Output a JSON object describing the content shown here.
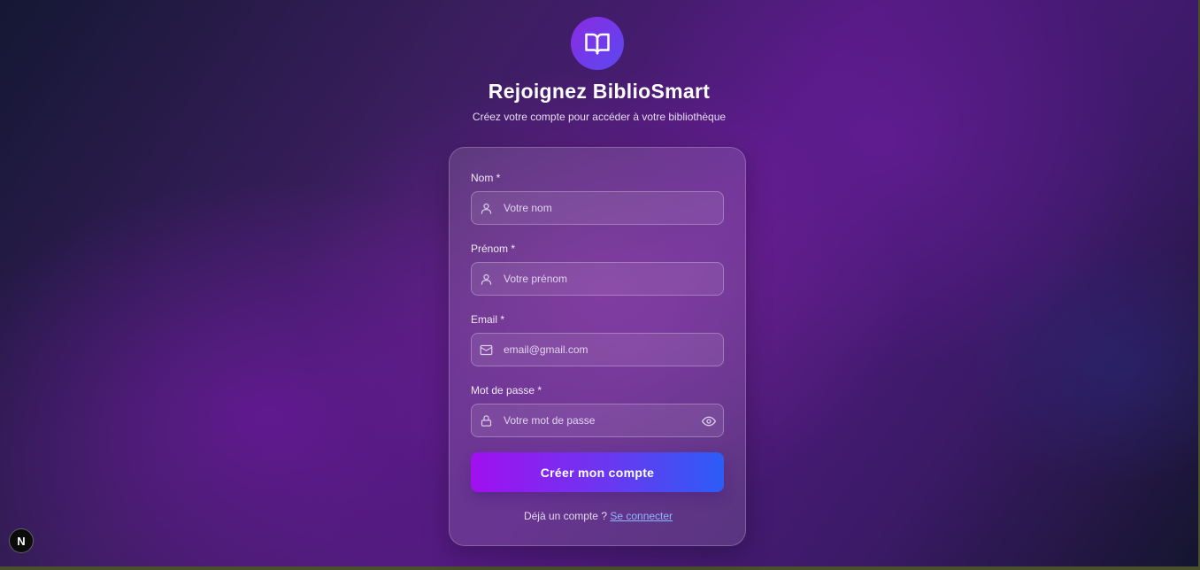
{
  "header": {
    "logo_icon": "open-book-icon",
    "title": "Rejoignez BiblioSmart",
    "subtitle": "Créez votre compte pour accéder à votre bibliothèque"
  },
  "form": {
    "fields": [
      {
        "label": "Nom *",
        "placeholder": "Votre nom",
        "icon": "user-icon"
      },
      {
        "label": "Prénom *",
        "placeholder": "Votre prénom",
        "icon": "user-icon"
      },
      {
        "label": "Email *",
        "placeholder": "email@gmail.com",
        "icon": "mail-icon"
      },
      {
        "label": "Mot de passe *",
        "placeholder": "Votre mot de passe",
        "icon": "lock-icon",
        "trailing_icon": "eye-icon"
      }
    ],
    "submit_label": "Créer mon compte",
    "footer_text": "Déjà un compte ? ",
    "footer_link": "Se connecter"
  },
  "dev_badge": {
    "label": "N"
  },
  "colors": {
    "accent_start": "#a010f0",
    "accent_end": "#2c5cf6",
    "link": "#8fb6ff"
  }
}
